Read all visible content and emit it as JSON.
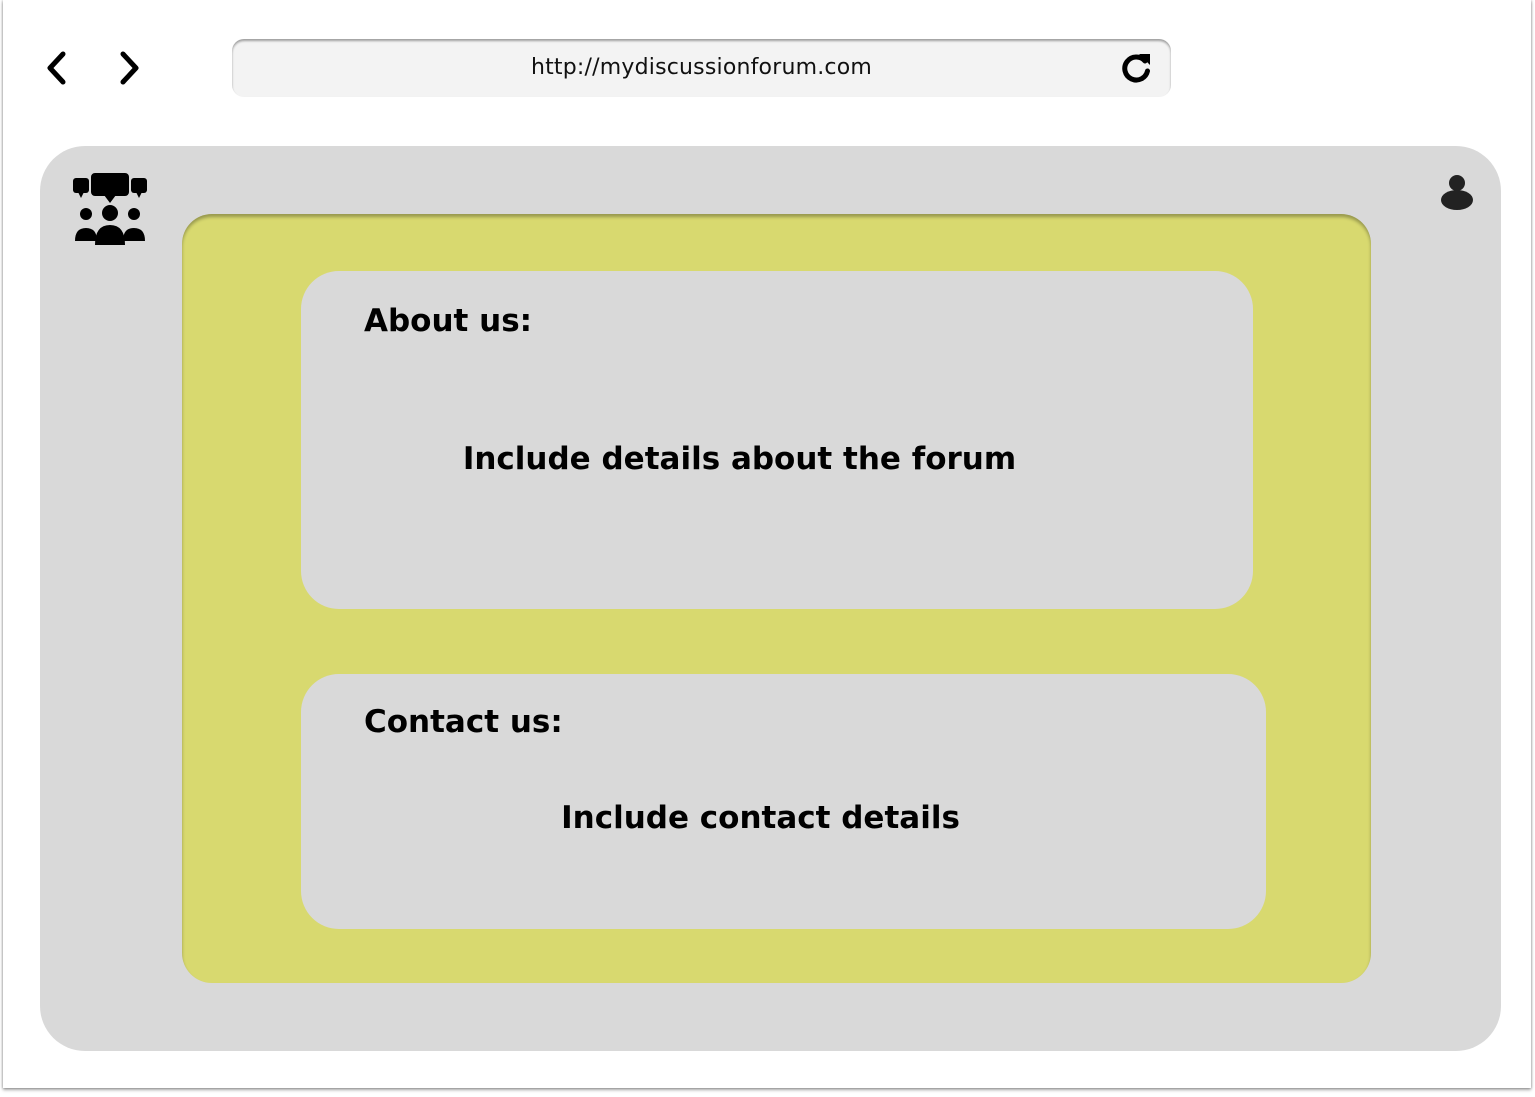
{
  "browser": {
    "url": "http://mydiscussionforum.com",
    "icons": {
      "back": "chevron-left-icon",
      "forward": "chevron-right-icon",
      "reload": "reload-icon"
    }
  },
  "header": {
    "logo_icon": "forum-group-icon",
    "user_icon": "user-icon"
  },
  "colors": {
    "page_background": "#d9d9d9",
    "panel_background": "#d8d96f",
    "card_background": "#d9d9d9"
  },
  "about": {
    "heading": "About us:",
    "body": "Include details about the forum"
  },
  "contact": {
    "heading": "Contact us:",
    "body": "Include contact details"
  }
}
